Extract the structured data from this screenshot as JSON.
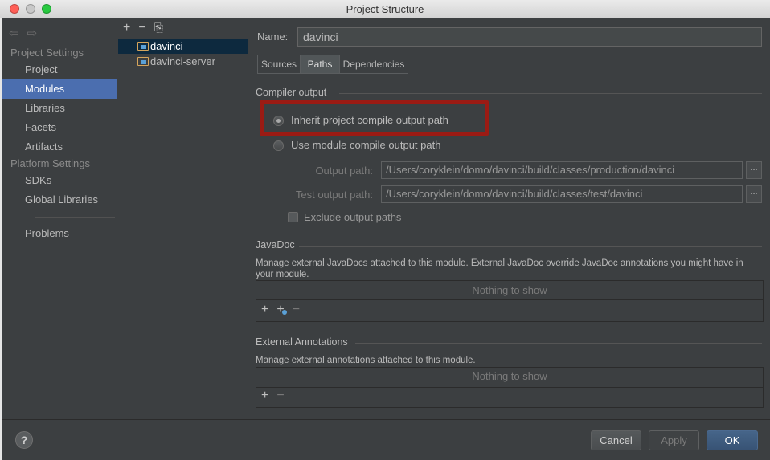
{
  "window": {
    "title": "Project Structure"
  },
  "sidebar": {
    "back_icon": "back-arrow-icon",
    "forward_icon": "forward-arrow-icon",
    "project_settings_header": "Project Settings",
    "project_items": [
      {
        "label": "Project"
      },
      {
        "label": "Modules"
      },
      {
        "label": "Libraries"
      },
      {
        "label": "Facets"
      },
      {
        "label": "Artifacts"
      }
    ],
    "platform_settings_header": "Platform Settings",
    "platform_items": [
      {
        "label": "SDKs"
      },
      {
        "label": "Global Libraries"
      }
    ],
    "problems_label": "Problems"
  },
  "modules": {
    "toolbar": {
      "add": "+",
      "remove": "−",
      "copy_icon": "copy-icon"
    },
    "items": [
      {
        "label": "davinci"
      },
      {
        "label": "davinci-server"
      }
    ]
  },
  "main": {
    "name_label": "Name:",
    "name_value": "davinci",
    "tabs": [
      {
        "label": "Sources"
      },
      {
        "label": "Paths"
      },
      {
        "label": "Dependencies"
      }
    ],
    "compiler_output": {
      "title": "Compiler output",
      "inherit_label": "Inherit project compile output path",
      "module_label": "Use module compile output path",
      "output_path_label": "Output path:",
      "output_path_value": "/Users/coryklein/domo/davinci/build/classes/production/davinci",
      "test_output_path_label": "Test output path:",
      "test_output_path_value": "/Users/coryklein/domo/davinci/build/classes/test/davinci",
      "browse_label": "...",
      "exclude_label": "Exclude output paths"
    },
    "javadoc": {
      "title": "JavaDoc",
      "description": "Manage external JavaDocs attached to this module. External JavaDoc override JavaDoc annotations you might have in your module.",
      "empty_text": "Nothing to show",
      "toolbar": {
        "add": "+",
        "add_url_icon": "add-url-icon",
        "remove": "−"
      }
    },
    "external_annotations": {
      "title": "External Annotations",
      "description": "Manage external annotations attached to this module.",
      "empty_text": "Nothing to show",
      "toolbar": {
        "add": "+",
        "remove": "−"
      }
    }
  },
  "footer": {
    "help_label": "?",
    "cancel_label": "Cancel",
    "apply_label": "Apply",
    "ok_label": "OK"
  },
  "colors": {
    "background": "#3c3f41",
    "selection": "#4b6eaf",
    "highlight_border": "#9b1b14"
  }
}
